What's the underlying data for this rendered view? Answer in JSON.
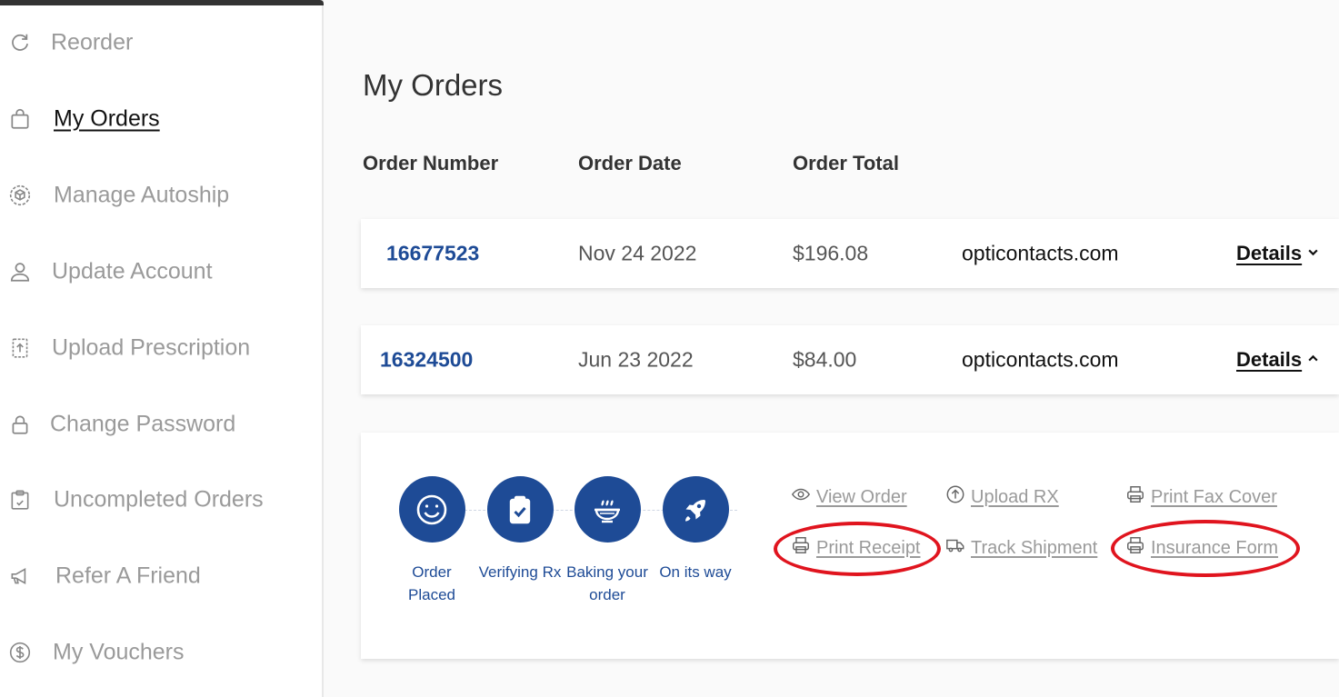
{
  "sidebar": {
    "items": [
      {
        "label": "Reorder",
        "icon": "refresh-icon"
      },
      {
        "label": "My Orders",
        "icon": "shopping-bag-icon",
        "active": true
      },
      {
        "label": "Manage Autoship",
        "icon": "autoship-icon"
      },
      {
        "label": "Update Account",
        "icon": "user-icon"
      },
      {
        "label": "Upload Prescription",
        "icon": "upload-file-icon"
      },
      {
        "label": "Change Password",
        "icon": "lock-icon"
      },
      {
        "label": "Uncompleted Orders",
        "icon": "clipboard-icon"
      },
      {
        "label": "Refer A Friend",
        "icon": "megaphone-icon"
      },
      {
        "label": "My Vouchers",
        "icon": "dollar-icon"
      }
    ]
  },
  "main": {
    "title": "My Orders",
    "columns": {
      "order_number": "Order Number",
      "order_date": "Order Date",
      "order_total": "Order Total"
    },
    "orders": [
      {
        "number": "16677523",
        "date": "Nov 24 2022",
        "total": "$196.08",
        "site": "opticontacts.com",
        "details_label": "Details",
        "expanded": false
      },
      {
        "number": "16324500",
        "date": "Jun 23 2022",
        "total": "$84.00",
        "site": "opticontacts.com",
        "details_label": "Details",
        "expanded": true
      }
    ],
    "status_steps": [
      {
        "line1": "Order",
        "line2": "Placed",
        "icon": "smiley-icon"
      },
      {
        "line1": "Verifying Rx",
        "line2": "",
        "icon": "clipboard-check-icon"
      },
      {
        "line1": "Baking your",
        "line2": "order",
        "icon": "baking-bowl-icon"
      },
      {
        "line1": "On its way",
        "line2": "",
        "icon": "rocket-icon"
      }
    ],
    "actions": {
      "view_order": "View Order",
      "upload_rx": "Upload RX",
      "print_fax_cover": "Print Fax Cover",
      "print_receipt": "Print Receipt",
      "track_shipment": "Track Shipment",
      "insurance_form": "Insurance Form"
    }
  },
  "colors": {
    "brand_blue": "#1e4b96",
    "highlight_red": "#e0141e",
    "muted_text": "#9a9a9a"
  }
}
